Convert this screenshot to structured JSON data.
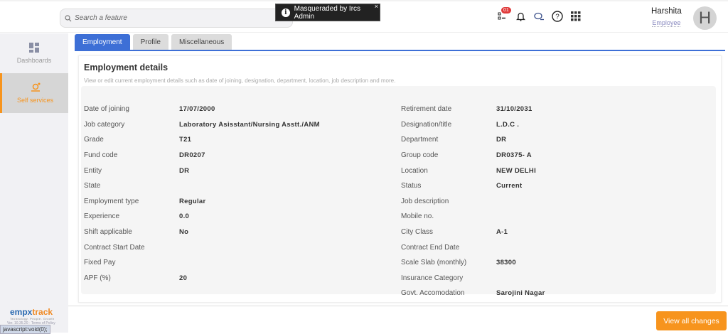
{
  "header": {
    "search_placeholder": "Search a feature",
    "toast": "Masqueraded by Ircs Admin",
    "toast_close": "×",
    "badge": "01",
    "user_name": "Harshita",
    "user_role": "Employee",
    "avatar_letter": "H"
  },
  "sidebar": {
    "items": [
      {
        "label": "Dashboards"
      },
      {
        "label": "Self services"
      }
    ],
    "logo": "empxtrack",
    "logo_b": "track",
    "logo_a": "empx",
    "tagline": "Technology. People. Growth",
    "version": "Ver. 10.35.20",
    "terms": "Terms of Policy",
    "status_url": "javascript:void(0);"
  },
  "tabs": [
    {
      "label": "Employment"
    },
    {
      "label": "Profile"
    },
    {
      "label": "Miscellaneous"
    }
  ],
  "card": {
    "title": "Employment details",
    "subtitle": "View or edit current employment details such as date of joining, designation, department, location, job description and more."
  },
  "left": [
    {
      "label": "Date of joining",
      "value": "17/07/2000"
    },
    {
      "label": "Job category",
      "value": "Laboratory Asisstant/Nursing Asstt./ANM"
    },
    {
      "label": "Grade",
      "value": "T21"
    },
    {
      "label": "Fund code",
      "value": "DR0207"
    },
    {
      "label": "Entity",
      "value": "DR"
    },
    {
      "label": "State",
      "value": ""
    },
    {
      "label": "Employment type",
      "value": "Regular"
    },
    {
      "label": "Experience",
      "value": "0.0"
    },
    {
      "label": "Shift applicable",
      "value": "No"
    },
    {
      "label": "Contract Start Date",
      "value": ""
    },
    {
      "label": "Fixed Pay",
      "value": ""
    },
    {
      "label": "APF (%)",
      "value": "20"
    }
  ],
  "right": [
    {
      "label": "Retirement date",
      "value": "31/10/2031"
    },
    {
      "label": "Designation/title",
      "value": "L.D.C ."
    },
    {
      "label": "Department",
      "value": "DR"
    },
    {
      "label": "Group code",
      "value": "DR0375- A"
    },
    {
      "label": "Location",
      "value": "NEW DELHI"
    },
    {
      "label": "Status",
      "value": "Current"
    },
    {
      "label": "Job description",
      "value": ""
    },
    {
      "label": "Mobile no.",
      "value": ""
    },
    {
      "label": "City Class",
      "value": "A-1"
    },
    {
      "label": "Contract End Date",
      "value": ""
    },
    {
      "label": "Scale Slab (monthly)",
      "value": "38300"
    },
    {
      "label": "Insurance Category",
      "value": ""
    },
    {
      "label": "Govt. Accomodation",
      "value": "Sarojini Nagar"
    }
  ],
  "footer": {
    "view_all": "View all changes"
  },
  "colors": {
    "accent": "#3d6fd6",
    "orange": "#f7941d"
  }
}
